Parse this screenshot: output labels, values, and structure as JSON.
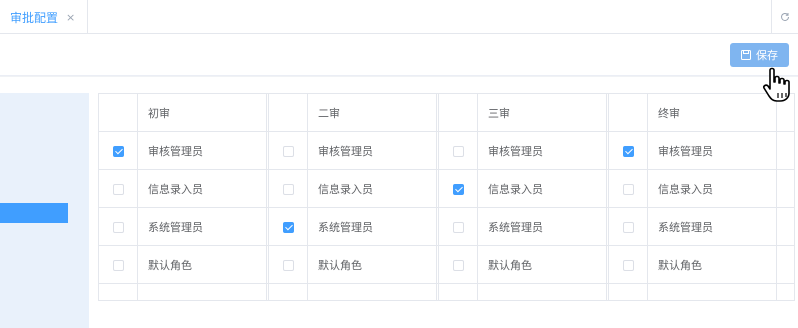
{
  "tabs": [
    {
      "label": "审批配置",
      "close": "×"
    }
  ],
  "toolbar": {
    "save_label": "保存"
  },
  "columns": [
    {
      "header": "初审",
      "rows": [
        {
          "label": "审核管理员",
          "checked": true
        },
        {
          "label": "信息录入员",
          "checked": false
        },
        {
          "label": "系统管理员",
          "checked": false
        },
        {
          "label": "默认角色",
          "checked": false
        }
      ]
    },
    {
      "header": "二审",
      "rows": [
        {
          "label": "审核管理员",
          "checked": false
        },
        {
          "label": "信息录入员",
          "checked": false
        },
        {
          "label": "系统管理员",
          "checked": true
        },
        {
          "label": "默认角色",
          "checked": false
        }
      ]
    },
    {
      "header": "三审",
      "rows": [
        {
          "label": "审核管理员",
          "checked": false
        },
        {
          "label": "信息录入员",
          "checked": true
        },
        {
          "label": "系统管理员",
          "checked": false
        },
        {
          "label": "默认角色",
          "checked": false
        }
      ]
    },
    {
      "header": "终审",
      "rows": [
        {
          "label": "审核管理员",
          "checked": true
        },
        {
          "label": "信息录入员",
          "checked": false
        },
        {
          "label": "系统管理员",
          "checked": false
        },
        {
          "label": "默认角色",
          "checked": false
        }
      ]
    }
  ],
  "colors": {
    "accent": "#409eff",
    "button": "#7fb5f0",
    "side_panel": "#e9f1fb"
  }
}
